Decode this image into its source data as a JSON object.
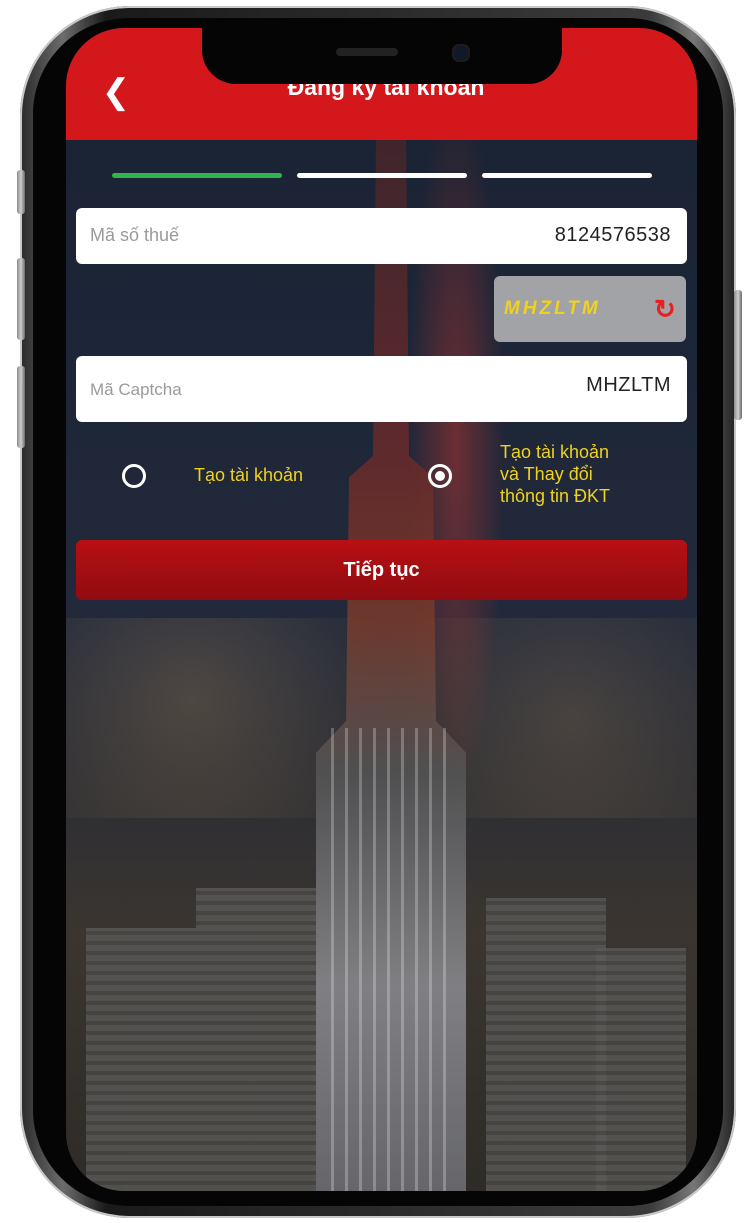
{
  "header": {
    "title": "Đăng ký tài khoản",
    "back_icon": "chevron-left-icon"
  },
  "steps": {
    "total": 3,
    "current": 1,
    "active_color": "#2fb54a",
    "inactive_color": "#ffffff"
  },
  "tax_field": {
    "placeholder": "Mã số thuế",
    "value": "8124576538"
  },
  "captcha": {
    "code": "MHZLTM",
    "refresh_icon": "refresh-icon"
  },
  "captcha_field": {
    "placeholder": "Mã Captcha",
    "value": "MHZLTM"
  },
  "options": [
    {
      "label": "Tạo tài khoản",
      "selected": false
    },
    {
      "label_lines": [
        "Tạo tài khoản",
        "và Thay đổi",
        "thông tin ĐKT"
      ],
      "selected": true
    }
  ],
  "submit_label": "Tiếp tục",
  "colors": {
    "header": "#d4171b",
    "button": "#a50d12",
    "option_text": "#f0d21e"
  }
}
